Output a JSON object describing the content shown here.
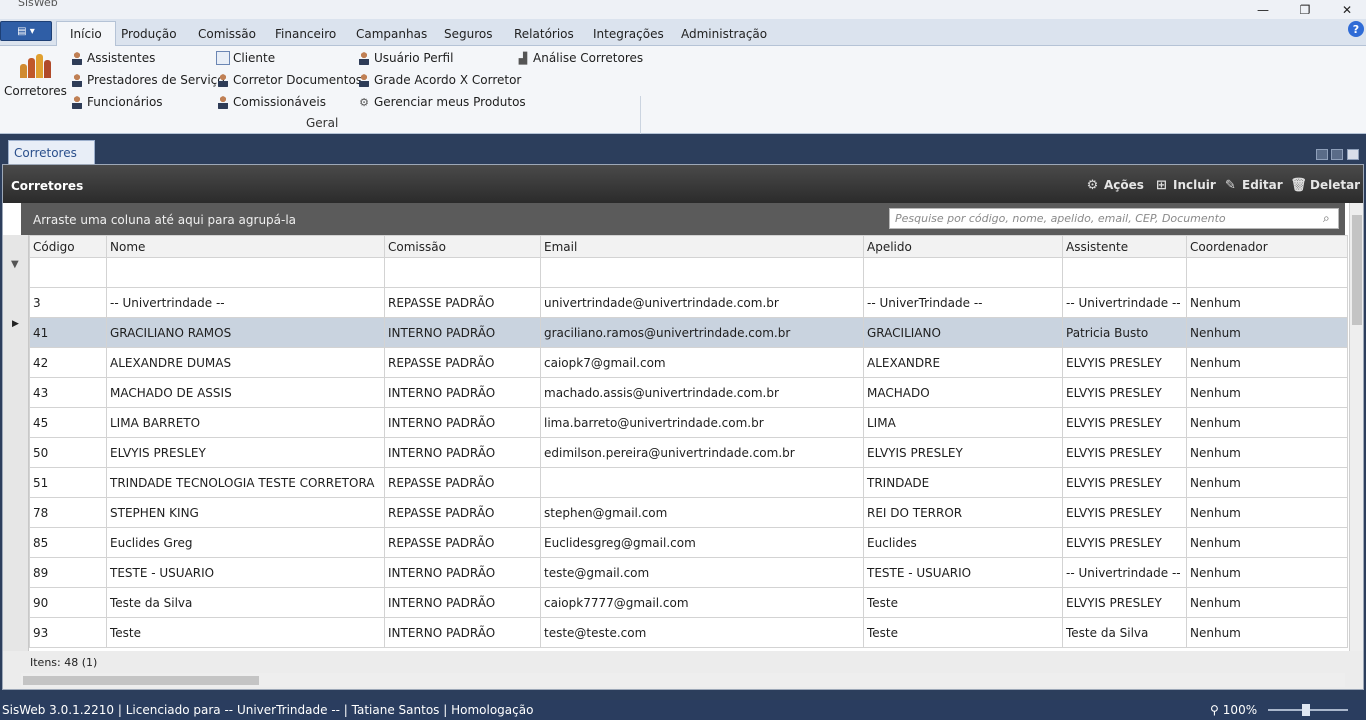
{
  "window": {
    "title": "SisWeb",
    "minimize": "—",
    "restore": "❐",
    "close": "✕"
  },
  "menu": {
    "app_button": "▤ ▾",
    "tabs": [
      "Início",
      "Produção",
      "Comissão",
      "Financeiro",
      "Campanhas",
      "Seguros",
      "Relatórios",
      "Integrações",
      "Administração"
    ],
    "help": "?"
  },
  "ribbon": {
    "big_button": "Corretores",
    "col1": [
      "Assistentes",
      "Prestadores de Serviço",
      "Funcionários"
    ],
    "col2": [
      "Cliente",
      "Corretor Documentos",
      "Comissionáveis"
    ],
    "col3": [
      "Usuário Perfil",
      "Grade Acordo X Corretor",
      "Gerenciar meus Produtos"
    ],
    "col4": [
      "Análise Corretores"
    ],
    "group_label": "Geral"
  },
  "doc_tab": "Corretores",
  "panel": {
    "title": "Corretores",
    "actions": [
      "Ações",
      "Incluir",
      "Editar",
      "Deletar"
    ],
    "group_hint": "Arraste uma coluna até aqui para agrupá-la",
    "search_placeholder": "Pesquise por código, nome, apelido, email, CEP, Documento",
    "footer": "Itens: 48 (1)"
  },
  "grid": {
    "columns": [
      "Código",
      "Nome",
      "Comissão",
      "Email",
      "Apelido",
      "Assistente",
      "Coordenador"
    ],
    "rows": [
      [
        "3",
        "-- Univertrindade --",
        "REPASSE PADRÃO",
        "univertrindade@univertrindade.com.br",
        "-- UniverTrindade --",
        "-- Univertrindade --",
        "Nenhum"
      ],
      [
        "41",
        "GRACILIANO RAMOS",
        "INTERNO PADRÃO",
        "graciliano.ramos@univertrindade.com.br",
        "GRACILIANO",
        "Patricia Busto",
        "Nenhum"
      ],
      [
        "42",
        "ALEXANDRE DUMAS",
        "REPASSE PADRÃO",
        "caiopk7@gmail.com",
        "ALEXANDRE",
        "ELVYIS PRESLEY",
        "Nenhum"
      ],
      [
        "43",
        "MACHADO DE ASSIS",
        "INTERNO PADRÃO",
        "machado.assis@univertrindade.com.br",
        "MACHADO",
        "ELVYIS PRESLEY",
        "Nenhum"
      ],
      [
        "45",
        "LIMA BARRETO",
        "INTERNO PADRÃO",
        "lima.barreto@univertrindade.com.br",
        "LIMA",
        "ELVYIS PRESLEY",
        "Nenhum"
      ],
      [
        "50",
        "ELVYIS PRESLEY",
        "INTERNO PADRÃO",
        "edimilson.pereira@univertrindade.com.br",
        "ELVYIS PRESLEY",
        "ELVYIS PRESLEY",
        "Nenhum"
      ],
      [
        "51",
        "TRINDADE TECNOLOGIA TESTE CORRETORA",
        "REPASSE PADRÃO",
        "",
        "TRINDADE",
        "ELVYIS PRESLEY",
        "Nenhum"
      ],
      [
        "78",
        "STEPHEN KING",
        "REPASSE PADRÃO",
        "stephen@gmail.com",
        "REI DO TERROR",
        "ELVYIS PRESLEY",
        "Nenhum"
      ],
      [
        "85",
        "Euclides Greg",
        "REPASSE PADRÃO",
        "Euclidesgreg@gmail.com",
        "Euclides",
        "ELVYIS PRESLEY",
        "Nenhum"
      ],
      [
        "89",
        "TESTE - USUARIO",
        "INTERNO PADRÃO",
        "teste@gmail.com",
        "TESTE - USUARIO",
        "-- Univertrindade --",
        "Nenhum"
      ],
      [
        "90",
        "Teste da Silva",
        "INTERNO PADRÃO",
        "caiopk7777@gmail.com",
        "Teste",
        "ELVYIS PRESLEY",
        "Nenhum"
      ],
      [
        "93",
        "Teste",
        "INTERNO PADRÃO",
        "teste@teste.com",
        "Teste",
        "Teste da Silva",
        "Nenhum"
      ]
    ],
    "selected_row": 1
  },
  "status": {
    "text": "SisWeb 3.0.1.2210 | Licenciado para -- UniverTrindade -- | Tatiane Santos | Homologação",
    "zoom": "100%"
  }
}
